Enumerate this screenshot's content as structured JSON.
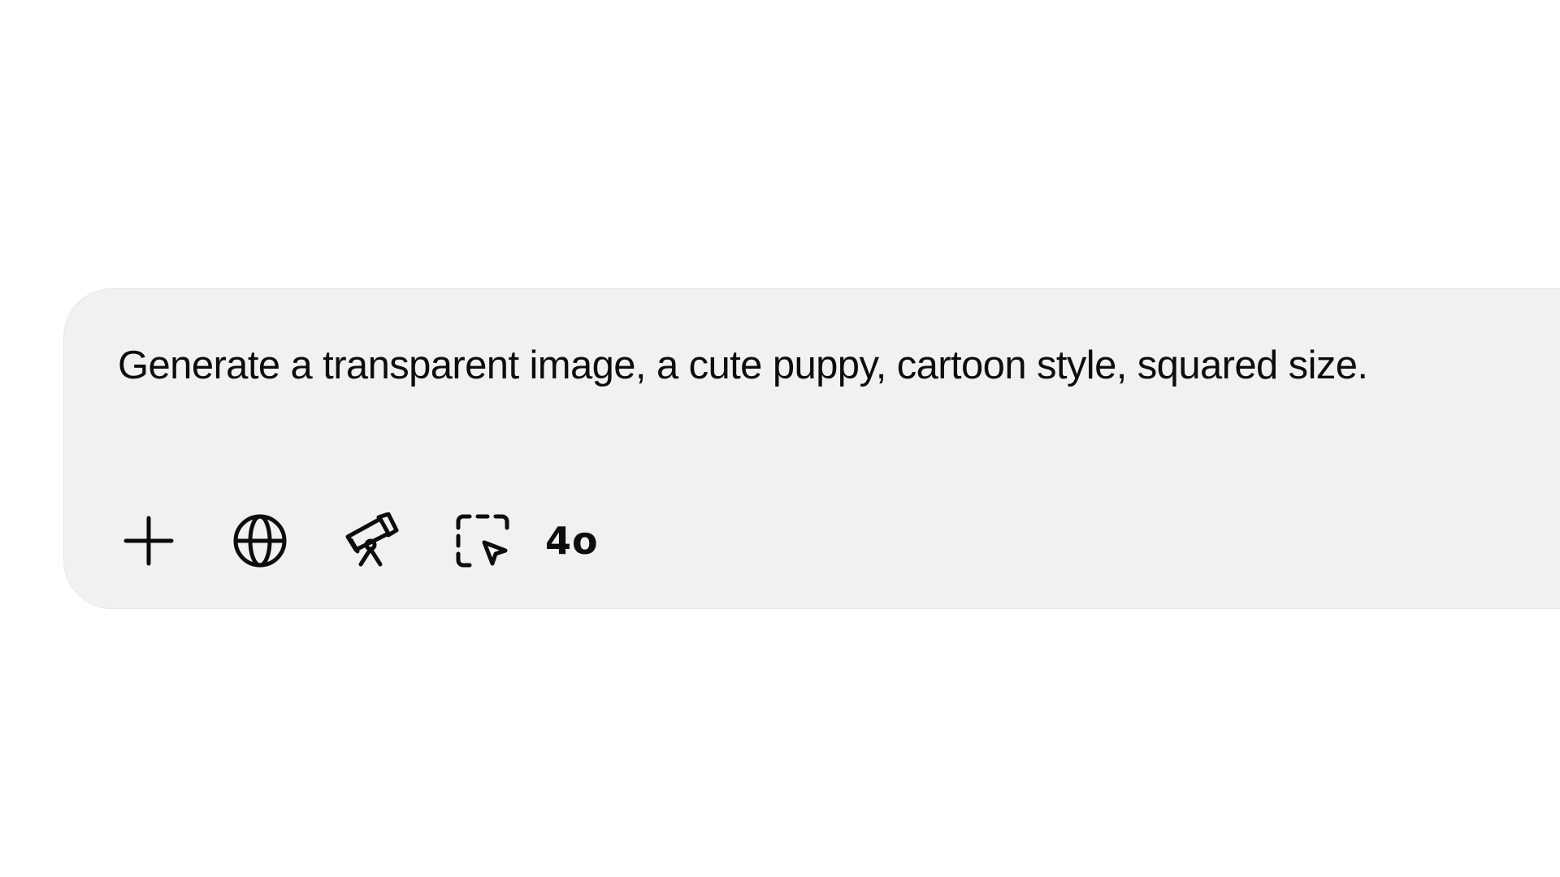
{
  "composer": {
    "prompt_text": "Generate a transparent image, a cute puppy, cartoon style, squared size.",
    "toolbar": {
      "tools": [
        {
          "name": "add",
          "icon": "plus-icon"
        },
        {
          "name": "search-web",
          "icon": "globe-icon"
        },
        {
          "name": "deep-research",
          "icon": "telescope-icon"
        },
        {
          "name": "operator",
          "icon": "select-cursor-icon"
        }
      ],
      "model_label": "4o"
    }
  },
  "colors": {
    "page_background": "#ffffff",
    "composer_background": "#f1f1f1",
    "text": "#0d0d0d"
  }
}
